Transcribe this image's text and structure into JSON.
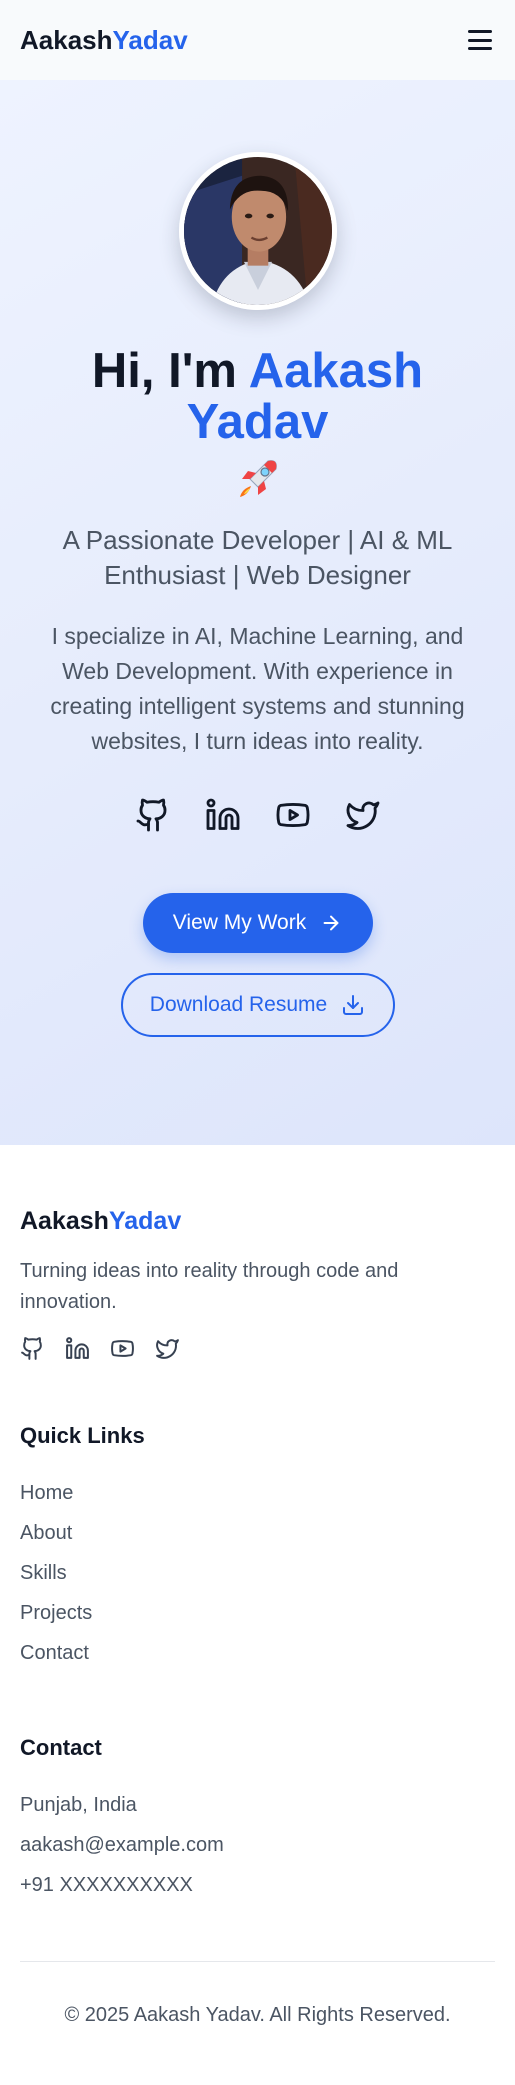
{
  "navbar": {
    "logo_first": "Aakash",
    "logo_second": "Yadav",
    "menu_icon": "hamburger-menu-icon"
  },
  "hero": {
    "greeting": "Hi, I'm ",
    "name": "Aakash Yadav",
    "emoji": "rocket-emoji",
    "subtitle": "A Passionate Developer | AI & ML Enthusiast | Web Designer",
    "description": "I specialize in AI, Machine Learning, and Web Development. With experience in creating intelligent systems and stunning websites, I turn ideas into reality.",
    "socials": [
      "github-icon",
      "linkedin-icon",
      "youtube-icon",
      "twitter-icon"
    ],
    "primary_button": "View My Work",
    "secondary_button": "Download Resume"
  },
  "footer": {
    "logo_first": "Aakash",
    "logo_second": "Yadav",
    "tagline": "Turning ideas into reality through code and innovation.",
    "quick_links_title": "Quick Links",
    "quick_links": [
      "Home",
      "About",
      "Skills",
      "Projects",
      "Contact"
    ],
    "contact_title": "Contact",
    "contact_items": [
      "Punjab, India",
      "aakash@example.com",
      "+91 XXXXXXXXXX"
    ],
    "copyright": "© 2025 Aakash Yadav. All Rights Reserved."
  },
  "colors": {
    "accent": "#2563eb",
    "heading": "#111827",
    "body_text": "#4b5563",
    "hero_background": "#e6ecfc"
  }
}
